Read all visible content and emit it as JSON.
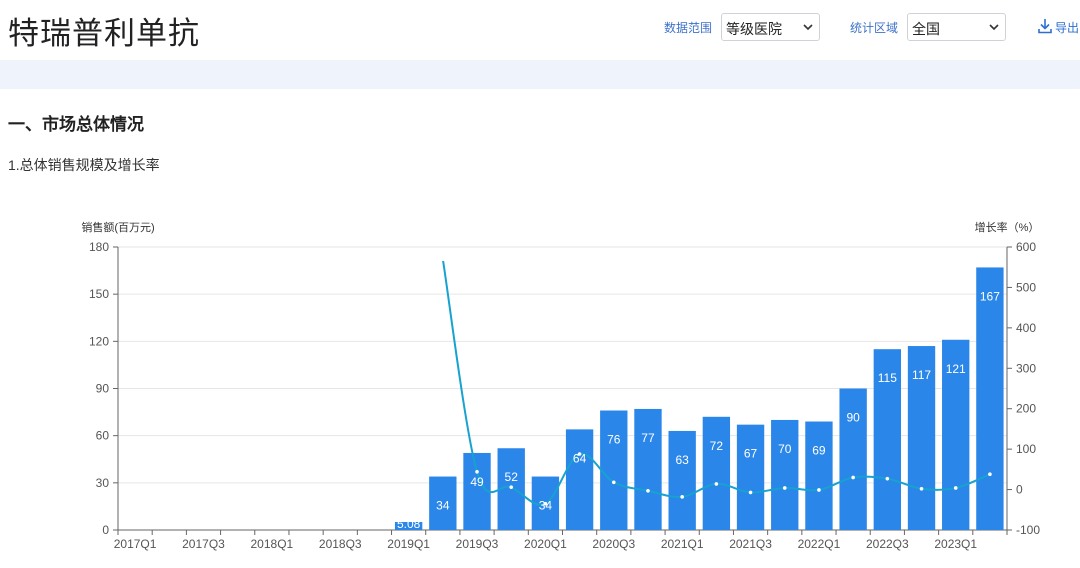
{
  "header": {
    "title": "特瑞普利单抗",
    "filters": [
      {
        "label": "数据范围",
        "value": "等级医院"
      },
      {
        "label": "统计区域",
        "value": "全国"
      }
    ],
    "export_label": "导出"
  },
  "section": {
    "title": "一、市场总体情况",
    "subtitle": "1.总体销售规模及增长率"
  },
  "colors": {
    "bar": "#2a86e8",
    "line": "#17a2cf",
    "accent": "#3d72c9"
  },
  "chart_data": {
    "type": "bar",
    "categories": [
      "2017Q1",
      "2017Q2",
      "2017Q3",
      "2017Q4",
      "2018Q1",
      "2018Q2",
      "2018Q3",
      "2018Q4",
      "2019Q1",
      "2019Q2",
      "2019Q3",
      "2019Q4",
      "2020Q1",
      "2020Q2",
      "2020Q3",
      "2020Q4",
      "2021Q1",
      "2021Q2",
      "2021Q3",
      "2021Q4",
      "2022Q1",
      "2022Q2",
      "2022Q3",
      "2022Q4",
      "2023Q1",
      "2023Q2"
    ],
    "xtick_labels": [
      "2017Q1",
      "",
      "2017Q3",
      "",
      "2018Q1",
      "",
      "2018Q3",
      "",
      "2019Q1",
      "",
      "2019Q3",
      "",
      "2020Q1",
      "",
      "2020Q3",
      "",
      "2021Q1",
      "",
      "2021Q3",
      "",
      "2022Q1",
      "",
      "2022Q3",
      "",
      "2023Q1",
      ""
    ],
    "series": [
      {
        "type": "bar",
        "axis": "left",
        "values": [
          null,
          null,
          null,
          null,
          null,
          null,
          null,
          null,
          5.08,
          34,
          49,
          52,
          34,
          64,
          76,
          77,
          63,
          72,
          67,
          70,
          69,
          90,
          115,
          117,
          121,
          167
        ],
        "labels": [
          "",
          "",
          "",
          "",
          "",
          "",
          "",
          "",
          "5.08",
          "34",
          "49",
          "52",
          "34",
          "64",
          "76",
          "77",
          "63",
          "72",
          "67",
          "70",
          "69",
          "90",
          "115",
          "117",
          "121",
          "167"
        ]
      },
      {
        "type": "line",
        "axis": "right",
        "values": [
          null,
          null,
          null,
          null,
          null,
          null,
          null,
          null,
          null,
          570,
          44,
          6,
          -35,
          88,
          18,
          -3,
          -18,
          14,
          -7,
          4,
          -1,
          30,
          27,
          2,
          4,
          38
        ]
      }
    ],
    "ylabel": "销售额(百万元)",
    "y2label": "增长率（%）",
    "ylim": [
      0,
      180
    ],
    "yticks": [
      0,
      30,
      60,
      90,
      120,
      150,
      180
    ],
    "y2lim": [
      -100,
      600
    ],
    "y2ticks": [
      -100,
      0,
      100,
      200,
      300,
      400,
      500,
      600
    ],
    "grid": true
  }
}
